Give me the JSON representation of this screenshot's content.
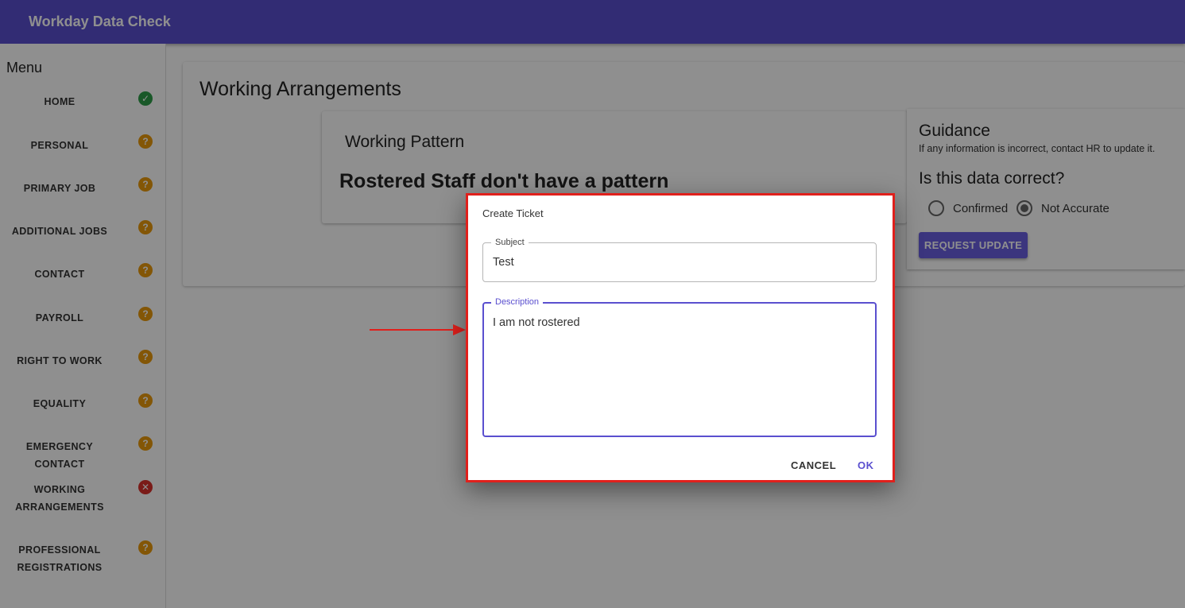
{
  "app": {
    "title": "Workday Data Check",
    "accent_color": "#5a4fcf"
  },
  "sidebar": {
    "title": "Menu",
    "items": [
      {
        "label": "HOME",
        "status": "complete",
        "icon": "check-circle-icon"
      },
      {
        "label": "PERSONAL",
        "status": "pending",
        "icon": "question-circle-icon"
      },
      {
        "label": "PRIMARY JOB",
        "status": "pending",
        "icon": "question-circle-icon"
      },
      {
        "label": "ADDITIONAL JOBS",
        "status": "pending",
        "icon": "question-circle-icon"
      },
      {
        "label": "CONTACT",
        "status": "pending",
        "icon": "question-circle-icon"
      },
      {
        "label": "PAYROLL",
        "status": "pending",
        "icon": "question-circle-icon"
      },
      {
        "label": "RIGHT TO WORK",
        "status": "pending",
        "icon": "question-circle-icon"
      },
      {
        "label": "EQUALITY",
        "status": "pending",
        "icon": "question-circle-icon"
      },
      {
        "label": "EMERGENCY CONTACT",
        "status": "pending",
        "icon": "question-circle-icon"
      },
      {
        "label_line1": "WORKING",
        "label_line2": "ARRANGEMENTS",
        "status": "error",
        "icon": "x-circle-icon"
      },
      {
        "label_line1": "PROFESSIONAL",
        "label_line2": "REGISTRATIONS",
        "status": "pending",
        "icon": "question-circle-icon"
      }
    ]
  },
  "main": {
    "heading": "Working Arrangements",
    "pattern_card": {
      "title": "Working Pattern",
      "message": "Rostered Staff don't have a pattern"
    }
  },
  "guidance": {
    "title": "Guidance",
    "text": "If any information is incorrect, contact HR to update it.",
    "question": "Is this data correct?",
    "options": [
      {
        "label": "Confirmed",
        "selected": false
      },
      {
        "label": "Not Accurate",
        "selected": true
      }
    ],
    "request_button": "REQUEST UPDATE"
  },
  "dialog": {
    "title": "Create Ticket",
    "subject_label": "Subject",
    "subject_value": "Test",
    "description_label": "Description",
    "description_value": "I am not rostered",
    "cancel_label": "CANCEL",
    "ok_label": "OK"
  }
}
